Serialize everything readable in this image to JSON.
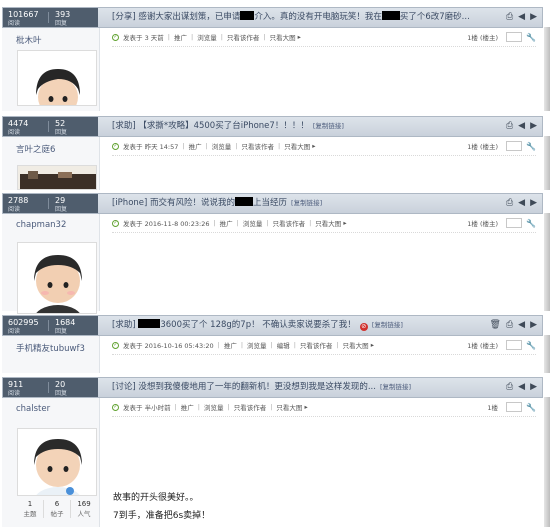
{
  "colors": {
    "header_stat_bg": "#4f5d6d",
    "title_text": "#3a4a63",
    "accent_green": "#62a332"
  },
  "posts": [
    {
      "views": "101667",
      "replies": "393",
      "title_a": "[分享] 感谢大家出谋划策，已申请",
      "title_b": "介入。真的没有开电脑玩笑！我在",
      "title_c": "买了个6改7磨砂...",
      "user": "枇木叶",
      "posted": "发表于 3 天前"
    },
    {
      "views": "4474",
      "replies": "52",
      "title": "[求助] 【求撕*攻略】4500买了台iPhone7！！！！",
      "perm": "[复制链接]",
      "user": "言叶之庭6",
      "posted": "发表于 昨天 14:57"
    },
    {
      "views": "2788",
      "replies": "29",
      "title_a": "[iPhone] 而交有风险！说说我的",
      "title_b": "上当经历",
      "perm": "[复制链接]",
      "user": "chapman32",
      "posted": "发表于 2016-11-8 00:23:26"
    },
    {
      "views": "602995",
      "replies": "1684",
      "title_a": "[求助]",
      "title_b": "3600买了个 128g的7p！ 不确认卖家说要杀了我！",
      "perm": "[复制链接]",
      "user": "手机精友tubuwf3",
      "posted": "发表于 2016-10-16 05:43:20",
      "edit": "编辑"
    },
    {
      "views": "911",
      "replies": "20",
      "title": "[讨论] 没想到我傻傻地用了一年的翻新机！更没想到我是这样发现的...",
      "perm": "[复制链接]",
      "user": "chalster",
      "posted": "发表于 半小时前",
      "stat_topics": "1",
      "stat_posts": "6",
      "stat_pop": "169",
      "label_topics": "主题",
      "label_posts": "帖子",
      "label_pop": "人气",
      "body_1": "故事的开头很美好。。",
      "body_2": "7到手，准备把6s卖掉！"
    }
  ],
  "labels": {
    "views": "阅读",
    "replies": "回复",
    "recommend": "推广",
    "browse": "浏览量",
    "author_only": "只看该作者",
    "big_img": "只看大图",
    "floor": "1楼 (楼主)",
    "floor_short": "1楼"
  },
  "icons": {
    "post": "post-dot-icon",
    "print": "print-icon",
    "prev": "prev-arrow-icon",
    "next": "next-arrow-icon",
    "wrench": "wrench-icon",
    "trash": "trash-icon",
    "no": "deny-icon"
  }
}
